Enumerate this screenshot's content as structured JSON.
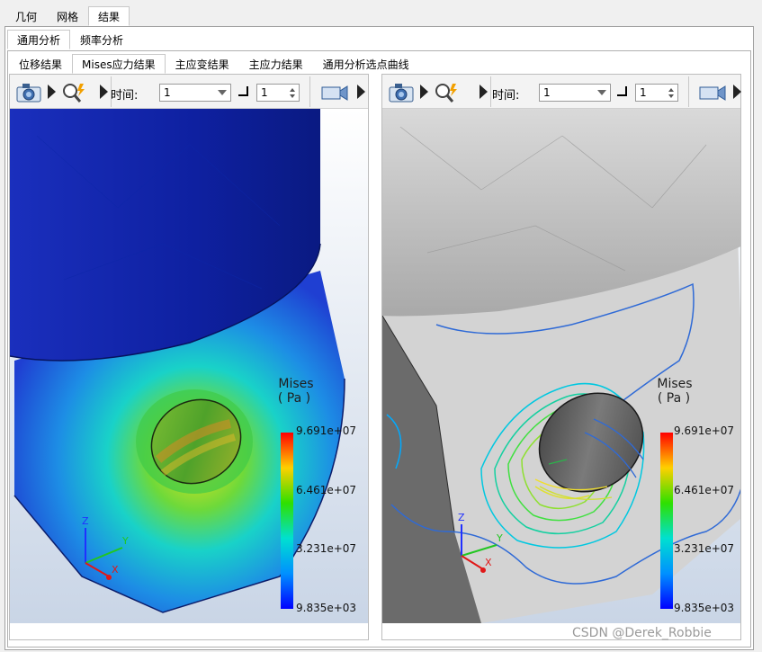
{
  "top_tabs": [
    {
      "label": "几何",
      "active": false
    },
    {
      "label": "网格",
      "active": false
    },
    {
      "label": "结果",
      "active": true
    }
  ],
  "sub_tabs": [
    {
      "label": "通用分析",
      "active": true
    },
    {
      "label": "频率分析",
      "active": false
    }
  ],
  "result_tabs": [
    {
      "label": "位移结果",
      "active": false
    },
    {
      "label": "Mises应力结果",
      "active": true
    },
    {
      "label": "主应变结果",
      "active": false
    },
    {
      "label": "主应力结果",
      "active": false
    },
    {
      "label": "通用分析选点曲线",
      "active": false
    }
  ],
  "views": [
    {
      "time_label": "时间:",
      "time_value": "1",
      "step_value": "1",
      "legend": {
        "title_line1": "Mises",
        "title_line2": "( Pa )",
        "max": "9.691e+07",
        "v2": "6.461e+07",
        "v3": "3.231e+07",
        "min": "9.835e+03"
      },
      "axes": {
        "z": "Z",
        "y": "Y",
        "x": "X"
      },
      "status": ":"
    },
    {
      "time_label": "时间:",
      "time_value": "1",
      "step_value": "1",
      "legend": {
        "title_line1": "Mises",
        "title_line2": "( Pa )",
        "max": "9.691e+07",
        "v2": "6.461e+07",
        "v3": "3.231e+07",
        "min": "9.835e+03"
      },
      "axes": {
        "z": "Z",
        "y": "Y",
        "x": "X"
      },
      "status": ":"
    }
  ],
  "watermark": "CSDN @Derek_Robbie",
  "icons": [
    "camera-icon",
    "zoom-magnifier-icon",
    "toolbar-grip-icon",
    "step-icon",
    "video-camera-icon"
  ],
  "colors": {
    "contour_min": "#0000ff",
    "contour_mid": "#00ff00",
    "contour_max": "#ff0000",
    "background_gradient_top": "#ffffff",
    "background_gradient_bottom": "#c9d5e6"
  }
}
